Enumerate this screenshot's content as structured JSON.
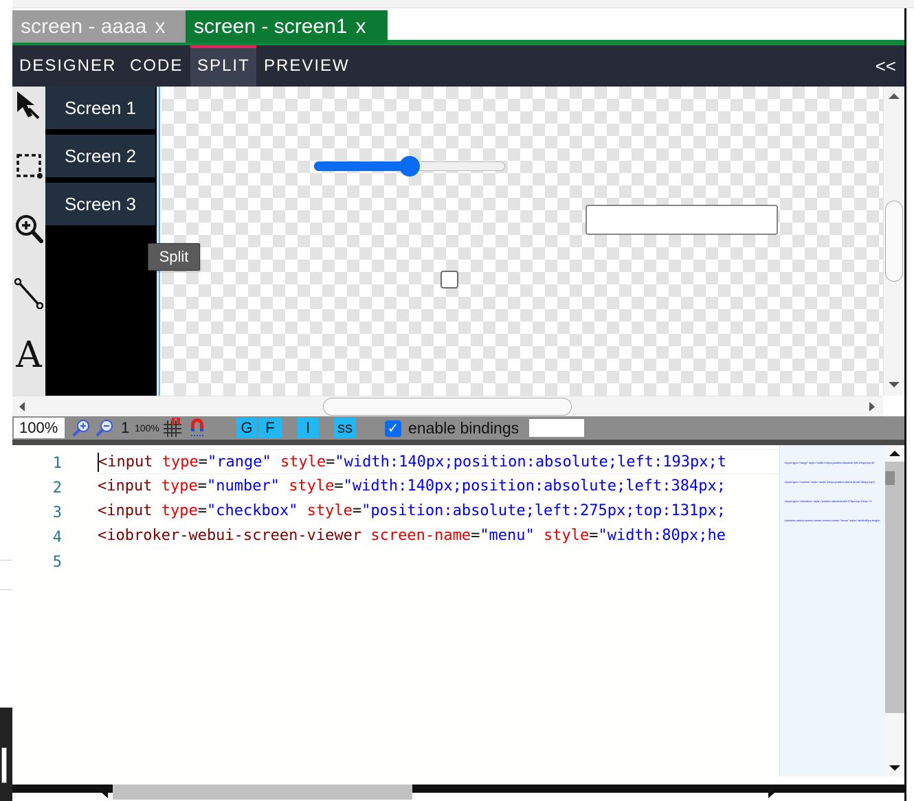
{
  "doc_tabs": [
    {
      "label": "screen - aaaa",
      "close": "x",
      "active": false
    },
    {
      "label": "screen - screen1",
      "close": "x",
      "active": true
    }
  ],
  "mode_tabs": [
    {
      "label": "DESIGNER"
    },
    {
      "label": "CODE"
    },
    {
      "label": "SPLIT",
      "active": true
    },
    {
      "label": "PREVIEW"
    }
  ],
  "collapse_label": "<<",
  "tools": [
    "pointer-icon",
    "select-rect-icon",
    "zoom-icon",
    "line-icon",
    "text-icon"
  ],
  "text_tool_glyph": "A",
  "screens": [
    {
      "label": "Screen 1"
    },
    {
      "label": "Screen 2"
    },
    {
      "label": "Screen 3"
    }
  ],
  "tooltip": "Split",
  "canvas": {
    "slider_value_fraction": 0.5,
    "checkbox_checked": false
  },
  "status_bar": {
    "zoom": "100%",
    "reset_label": "1",
    "zoom_100_label": "100%",
    "buttons": [
      "G",
      "F",
      "I",
      "ss"
    ],
    "enable_bindings_label": "enable bindings",
    "enable_bindings_checked": true
  },
  "code": {
    "line_numbers": [
      "1",
      "2",
      "3",
      "4",
      "5"
    ],
    "lines": [
      {
        "tag": "<input",
        "a1": "type",
        "v1": "\"range\"",
        "a2": "style",
        "v2": "\"width:140px;position:absolute;left:193px;t"
      },
      {
        "tag": "<input",
        "a1": "type",
        "v1": "\"number\"",
        "a2": "style",
        "v2": "\"width:140px;position:absolute;left:384px;"
      },
      {
        "tag": "<input",
        "a1": "type",
        "v1": "\"checkbox\"",
        "a2": "style",
        "v2": "\"position:absolute;left:275px;top:131px;"
      },
      {
        "tag": "<iobroker-webui-screen-viewer",
        "a1": "screen-name",
        "v1": "\"menu\"",
        "a2": "style",
        "v2": "\"width:80px;he"
      },
      {
        "tag": "",
        "a1": "",
        "v1": "",
        "a2": "",
        "v2": ""
      }
    ],
    "minimap_lines": [
      "<input type=\"range\" style=\"width:140px;position:absolute;left:193px;top:40",
      "<input type=\"number\" style=\"width:140px;position:absolute;left:384px;top:0",
      "<input type=\"checkbox\" style=\"position:absolute;left:275px;top:131px;\"/>",
      "<iobroker-webui-screen-viewer screen-name=\"menu\" style=\"width:80px;height:"
    ]
  }
}
